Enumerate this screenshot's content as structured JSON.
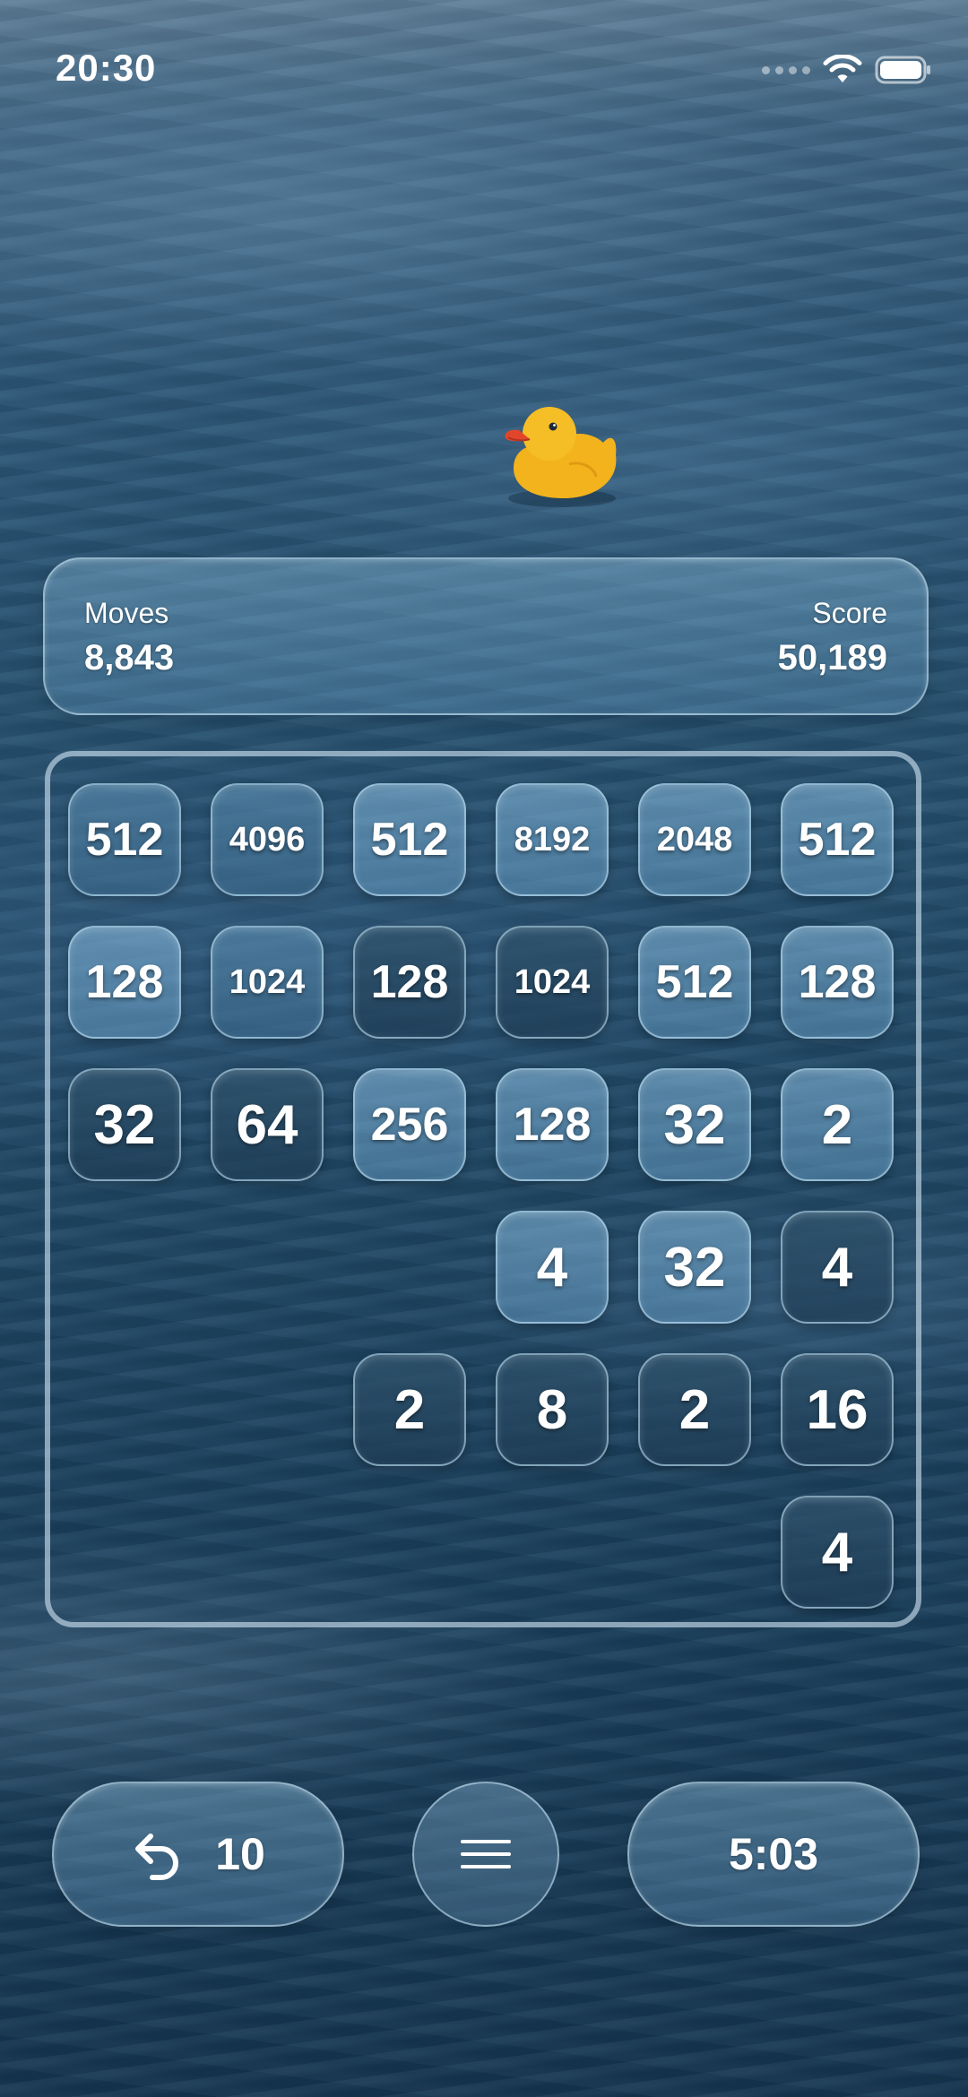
{
  "status_bar": {
    "time": "20:30"
  },
  "stats": {
    "moves_label": "Moves",
    "moves_value": "8,843",
    "score_label": "Score",
    "score_value": "50,189"
  },
  "board": {
    "rows": 6,
    "cols": 6,
    "tiles": [
      [
        "512",
        "4096",
        "512",
        "8192",
        "2048",
        "512"
      ],
      [
        "128",
        "1024",
        "128",
        "1024",
        "512",
        "128"
      ],
      [
        "32",
        "64",
        "256",
        "128",
        "32",
        "2"
      ],
      [
        "",
        "",
        "",
        "4",
        "32",
        "4"
      ],
      [
        "",
        "",
        "2",
        "8",
        "2",
        "16"
      ],
      [
        "",
        "",
        "",
        "",
        "",
        "4"
      ]
    ],
    "tile_tones": [
      [
        "mid",
        "mid",
        "light",
        "light",
        "light",
        "light"
      ],
      [
        "light",
        "mid",
        "dark",
        "dark",
        "light",
        "light"
      ],
      [
        "dark",
        "dark",
        "light",
        "light",
        "light",
        "light"
      ],
      [
        "",
        "",
        "",
        "light",
        "light",
        "dark"
      ],
      [
        "",
        "",
        "dark",
        "dark",
        "dark",
        "dark"
      ],
      [
        "",
        "",
        "",
        "",
        "",
        "dark"
      ]
    ]
  },
  "controls": {
    "undo_icon": "undo-arrow-icon",
    "undo_count": "10",
    "menu_icon": "hamburger-menu-icon",
    "timer": "5:03"
  },
  "colors": {
    "duck_body": "#f5b820",
    "duck_beak": "#e2462a"
  }
}
